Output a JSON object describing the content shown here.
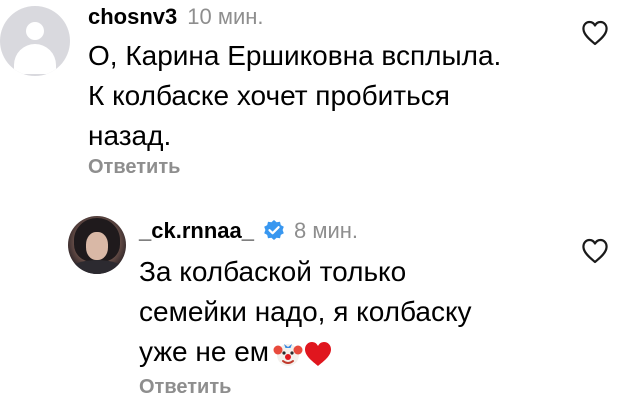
{
  "comments": [
    {
      "username": "chosnv3",
      "time": "10 мин.",
      "text": "О, Карина Ершиковна всплыла.\nК колбаске хочет пробиться\nназад.",
      "reply_label": "Ответить",
      "avatar": "default-avatar-icon",
      "like_icon": "heart-outline-icon"
    },
    {
      "username": "_ck.rnnaa_",
      "verified": true,
      "time": "8 мин.",
      "text": "За колбаской только\nсемейки надо, я колбаску\nуже не ем",
      "emojis": [
        "clown-face-icon",
        "red-heart-icon"
      ],
      "reply_label": "Ответить",
      "avatar": "user-photo",
      "like_icon": "heart-outline-icon"
    }
  ],
  "colors": {
    "muted": "#8e8e8e",
    "verified_badge": "#3897f0",
    "heart": "#e0161e"
  }
}
